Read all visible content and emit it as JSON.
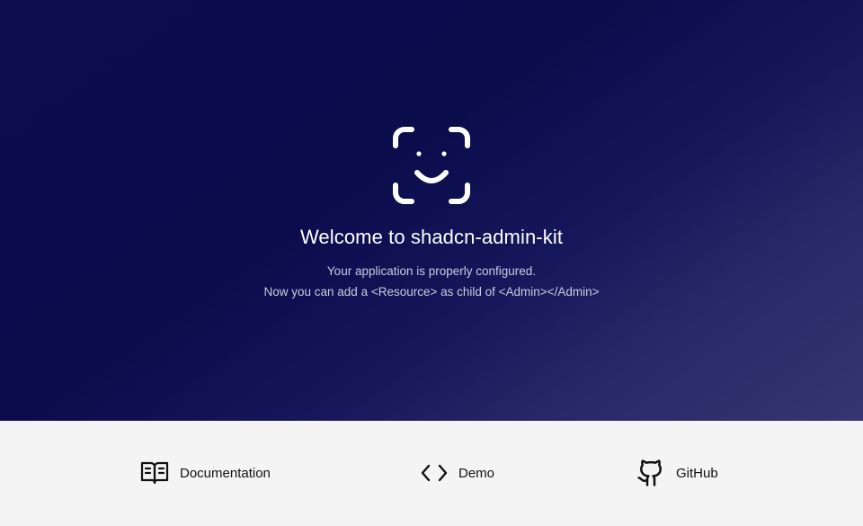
{
  "hero": {
    "logo_icon": "face-scan-smile-icon",
    "title": "Welcome to shadcn-admin-kit",
    "subtitle_line1": "Your application is properly configured.",
    "subtitle_line2": "Now you can add a <Resource> as child of <Admin></Admin>"
  },
  "footer": {
    "links": [
      {
        "label": "Documentation",
        "icon": "book-open-icon"
      },
      {
        "label": "Demo",
        "icon": "code-icon"
      },
      {
        "label": "GitHub",
        "icon": "github-icon"
      }
    ]
  },
  "colors": {
    "hero_background": "#0b0d4f",
    "footer_background": "#f4f4f4",
    "title_text": "#ffffff",
    "subtitle_text": "#c9cbe0",
    "link_text": "#111111"
  }
}
